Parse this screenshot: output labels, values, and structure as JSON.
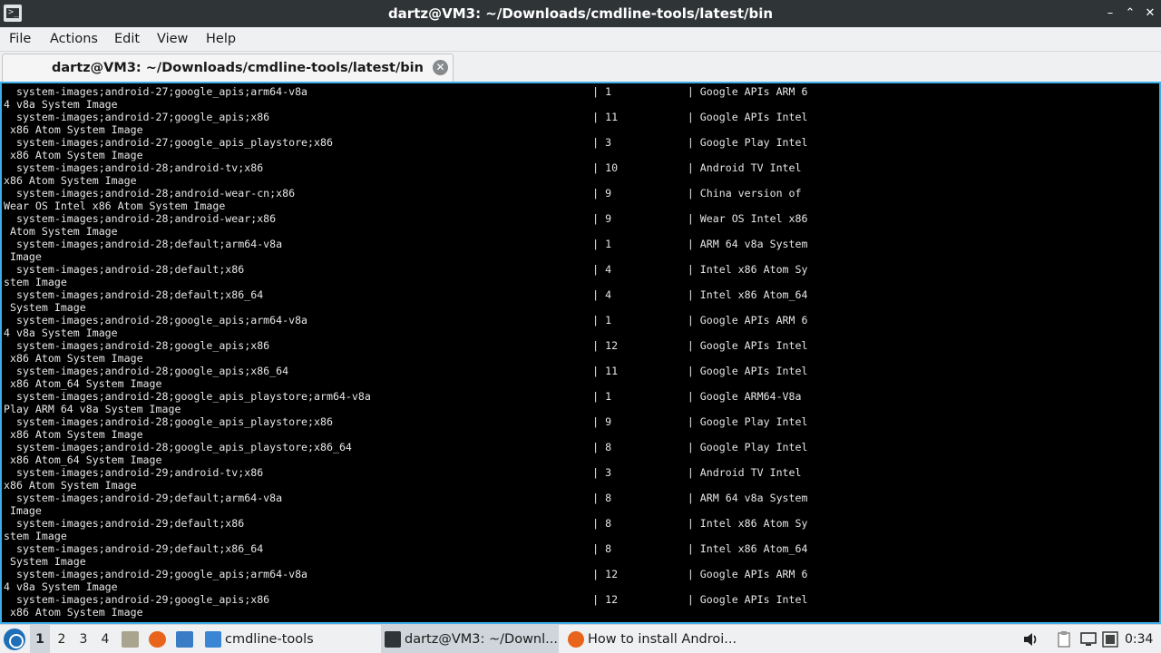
{
  "window": {
    "title": "dartz@VM3: ~/Downloads/cmdline-tools/latest/bin",
    "app_icon_glyph": ">_",
    "controls": {
      "minimize": "–",
      "restore": "⌃",
      "close": "✕"
    }
  },
  "menubar": {
    "file": "File",
    "actions": "Actions",
    "edit": "Edit",
    "view": "View",
    "help": "Help"
  },
  "tab": {
    "label": "dartz@VM3: ~/Downloads/cmdline-tools/latest/bin",
    "close_glyph": "✕"
  },
  "terminal": {
    "lines": [
      "  system-images;android-27;google_apis;arm64-v8a                                             | 1            | Google APIs ARM 6",
      "4 v8a System Image",
      "  system-images;android-27;google_apis;x86                                                   | 11           | Google APIs Intel",
      " x86 Atom System Image",
      "  system-images;android-27;google_apis_playstore;x86                                         | 3            | Google Play Intel",
      " x86 Atom System Image",
      "  system-images;android-28;android-tv;x86                                                    | 10           | Android TV Intel",
      "x86 Atom System Image",
      "  system-images;android-28;android-wear-cn;x86                                               | 9            | China version of",
      "Wear OS Intel x86 Atom System Image",
      "  system-images;android-28;android-wear;x86                                                  | 9            | Wear OS Intel x86",
      " Atom System Image",
      "  system-images;android-28;default;arm64-v8a                                                 | 1            | ARM 64 v8a System",
      " Image",
      "  system-images;android-28;default;x86                                                       | 4            | Intel x86 Atom Sy",
      "stem Image",
      "  system-images;android-28;default;x86_64                                                    | 4            | Intel x86 Atom_64",
      " System Image",
      "  system-images;android-28;google_apis;arm64-v8a                                             | 1            | Google APIs ARM 6",
      "4 v8a System Image",
      "  system-images;android-28;google_apis;x86                                                   | 12           | Google APIs Intel",
      " x86 Atom System Image",
      "  system-images;android-28;google_apis;x86_64                                                | 11           | Google APIs Intel",
      " x86 Atom_64 System Image",
      "  system-images;android-28;google_apis_playstore;arm64-v8a                                   | 1            | Google ARM64-V8a",
      "Play ARM 64 v8a System Image",
      "  system-images;android-28;google_apis_playstore;x86                                         | 9            | Google Play Intel",
      " x86 Atom System Image",
      "  system-images;android-28;google_apis_playstore;x86_64                                      | 8            | Google Play Intel",
      " x86 Atom_64 System Image",
      "  system-images;android-29;android-tv;x86                                                    | 3            | Android TV Intel",
      "x86 Atom System Image",
      "  system-images;android-29;default;arm64-v8a                                                 | 8            | ARM 64 v8a System",
      " Image",
      "  system-images;android-29;default;x86                                                       | 8            | Intel x86 Atom Sy",
      "stem Image",
      "  system-images;android-29;default;x86_64                                                    | 8            | Intel x86 Atom_64",
      " System Image",
      "  system-images;android-29;google_apis;arm64-v8a                                             | 12           | Google APIs ARM 6",
      "4 v8a System Image",
      "  system-images;android-29;google_apis;x86                                                   | 12           | Google APIs Intel",
      " x86 Atom System Image"
    ]
  },
  "taskbar": {
    "workspaces": [
      "1",
      "2",
      "3",
      "4"
    ],
    "active_workspace": "1",
    "tasks": {
      "file_manager": "cmdline-tools",
      "terminal": "dartz@VM3: ~/Downl...",
      "browser": "How to install Androi..."
    },
    "clock": "0:34"
  },
  "colors": {
    "titlebar": "#2f3437",
    "accent": "#3daee9",
    "terminal_bg": "#000000",
    "terminal_fg": "#e6e6e6",
    "panel": "#eff0f1"
  }
}
